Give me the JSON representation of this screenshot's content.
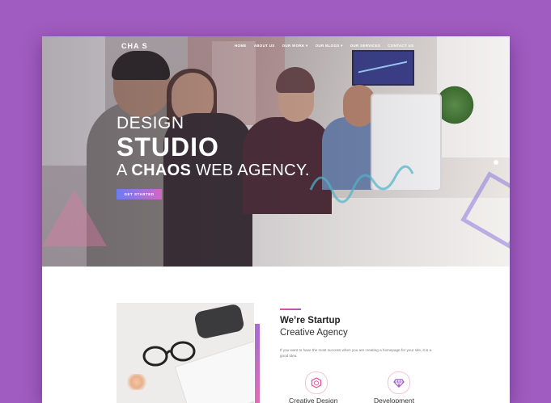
{
  "brand": {
    "logo": "CHA  S"
  },
  "nav": {
    "items": [
      "HOME",
      "ABOUT US",
      "OUR WORK ▾",
      "OUR BLOGS ▾",
      "OUR SERVICES",
      "CONTACT US"
    ]
  },
  "hero": {
    "line1": "DESIGN",
    "line2": "STUDIO",
    "line3_prefix": "A ",
    "line3_bold": "CHAOS",
    "line3_suffix": " WEB AGENCY.",
    "cta_label": "GET STARTED"
  },
  "about": {
    "title_bold": "We’re Startup",
    "title_light": "Creative Agency",
    "body": "If you want to have the most success when you are creating a homepage for your site, it is a good idea."
  },
  "services": [
    {
      "label": "Creative Design",
      "icon": "hexagon-icon"
    },
    {
      "label": "Development",
      "icon": "diamond-icon"
    }
  ],
  "colors": {
    "page_bg": "#a05cc0",
    "accent_gradient_start": "#6a7df0",
    "accent_gradient_end": "#d366c8",
    "accent_pink": "#e74e9b"
  }
}
